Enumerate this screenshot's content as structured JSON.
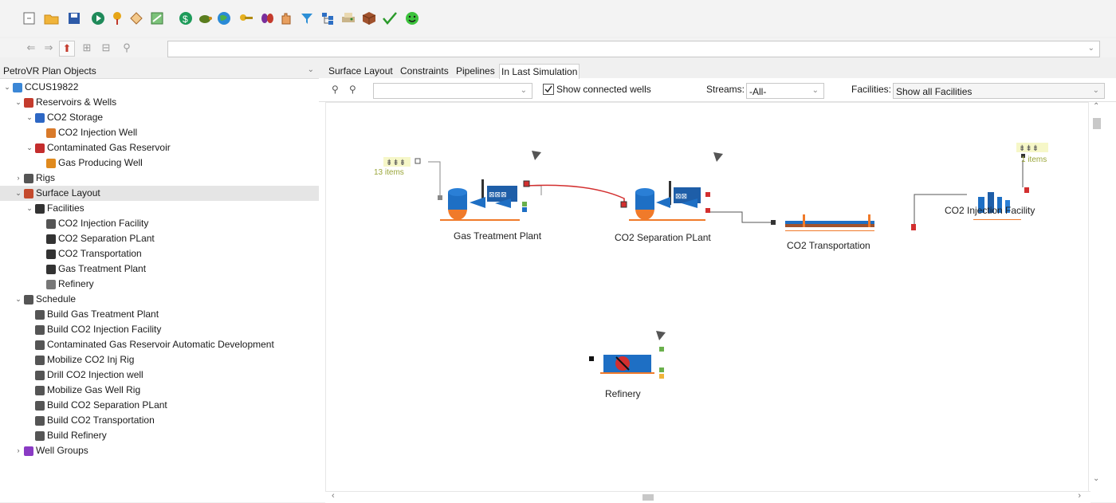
{
  "toolbar": {
    "icons": [
      "new-file-icon",
      "open-folder-icon",
      "save-icon",
      "run-icon",
      "location-pin-icon",
      "tag-icon",
      "report-icon",
      "dollar-icon",
      "turtle-icon",
      "globe-icon",
      "keys-icon",
      "bugs-icon",
      "hand-icon",
      "filter-icon",
      "hierarchy-icon",
      "print-icon",
      "cube-icon",
      "checkmark-icon",
      "smiley-icon"
    ]
  },
  "left_panel": {
    "title": "PetroVR Plan Objects",
    "tree": [
      {
        "label": "CCUS19822",
        "level": 0,
        "exp": "v",
        "icon": "#3b87d6"
      },
      {
        "label": "Reservoirs & Wells",
        "level": 1,
        "exp": "v",
        "icon": "#c43b2d"
      },
      {
        "label": "CO2 Storage",
        "level": 2,
        "exp": "v",
        "icon": "#2d67c4"
      },
      {
        "label": "CO2 Injection Well",
        "level": 3,
        "exp": "",
        "icon": "#d97a2a"
      },
      {
        "label": "Contaminated Gas Reservoir",
        "level": 2,
        "exp": "v",
        "icon": "#c42d2d"
      },
      {
        "label": "Gas Producing Well",
        "level": 3,
        "exp": "",
        "icon": "#e08a1e"
      },
      {
        "label": "Rigs",
        "level": 1,
        "exp": ">",
        "icon": "#555555"
      },
      {
        "label": "Surface Layout",
        "level": 1,
        "exp": "v",
        "icon": "#c44a2d"
      },
      {
        "label": "Facilities",
        "level": 2,
        "exp": "v",
        "icon": "#333333"
      },
      {
        "label": "CO2 Injection Facility",
        "level": 3,
        "exp": "",
        "icon": "#555555"
      },
      {
        "label": "CO2 Separation PLant",
        "level": 3,
        "exp": "",
        "icon": "#333333"
      },
      {
        "label": "CO2 Transportation",
        "level": 3,
        "exp": "",
        "icon": "#333333"
      },
      {
        "label": "Gas Treatment Plant",
        "level": 3,
        "exp": "",
        "icon": "#333333"
      },
      {
        "label": "Refinery",
        "level": 3,
        "exp": "",
        "icon": "#777777"
      },
      {
        "label": "Schedule",
        "level": 1,
        "exp": "v",
        "icon": "#555555"
      },
      {
        "label": "Build Gas Treatment Plant",
        "level": 2,
        "exp": "",
        "icon": "#555555"
      },
      {
        "label": "Build CO2 Injection Facility",
        "level": 2,
        "exp": "",
        "icon": "#555555"
      },
      {
        "label": "Contaminated Gas Reservoir Automatic Development",
        "level": 2,
        "exp": "",
        "icon": "#555555"
      },
      {
        "label": "Mobilize CO2 Inj Rig",
        "level": 2,
        "exp": "",
        "icon": "#555555"
      },
      {
        "label": "Drill CO2 Injection well",
        "level": 2,
        "exp": "",
        "icon": "#555555"
      },
      {
        "label": "Mobilize Gas Well Rig",
        "level": 2,
        "exp": "",
        "icon": "#555555"
      },
      {
        "label": "Build CO2 Separation PLant",
        "level": 2,
        "exp": "",
        "icon": "#555555"
      },
      {
        "label": "Build CO2 Transportation",
        "level": 2,
        "exp": "",
        "icon": "#555555"
      },
      {
        "label": "Build Refinery",
        "level": 2,
        "exp": "",
        "icon": "#555555"
      },
      {
        "label": "Well Groups",
        "level": 1,
        "exp": ">",
        "icon": "#8a3bc4"
      }
    ],
    "selected_label": "Surface Layout"
  },
  "tabs": [
    {
      "label": "Surface Layout",
      "active": false
    },
    {
      "label": "Constraints",
      "active": false
    },
    {
      "label": "Pipelines",
      "active": false
    },
    {
      "label": "In Last Simulation",
      "active": true
    }
  ],
  "filterbar": {
    "search_value": "",
    "show_connected_wells_label": "Show connected wells",
    "show_connected_wells_checked": true,
    "streams_label": "Streams:",
    "streams_value": "-All-",
    "facilities_label": "Facilities:",
    "facilities_value": "Show all Facilities"
  },
  "diagram": {
    "gas_treatment_label": "Gas Treatment Plant",
    "co2_separation_label": "CO2 Separation PLant",
    "co2_transportation_label": "CO2 Transportation",
    "co2_injection_label": "CO2 Injection Facility",
    "refinery_label": "Refinery",
    "wells_badge_1": "13 items",
    "wells_badge_2": "1 items"
  },
  "colors": {
    "accent_red": "#d32f2f",
    "vessel_blue": "#1e6fc4",
    "vessel_orange": "#f07a2a",
    "badge_yellow": "#f6f7c8"
  }
}
